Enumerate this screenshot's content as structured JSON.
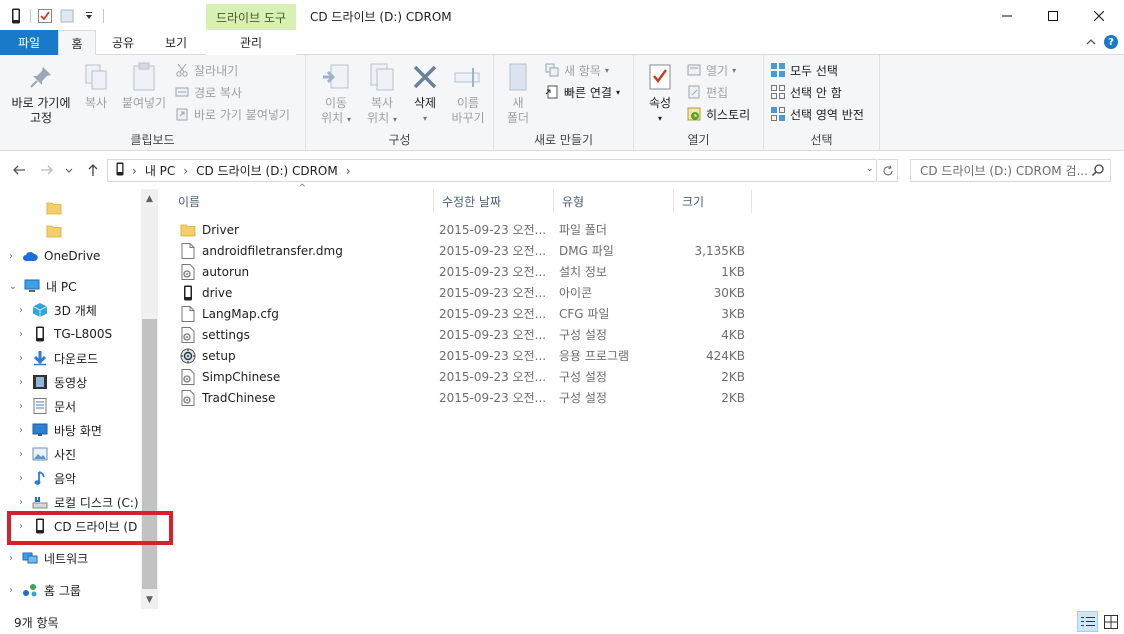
{
  "window": {
    "title": "CD 드라이브 (D:) CDROM",
    "context_tab_header": "드라이브 도구"
  },
  "ribbon_tabs": {
    "file": "파일",
    "home": "홈",
    "share": "공유",
    "view": "보기",
    "manage": "관리"
  },
  "ribbon": {
    "clipboard": {
      "label": "클립보드",
      "pin_line1": "바로 가기에",
      "pin_line2": "고정",
      "copy": "복사",
      "paste": "붙여넣기",
      "cut": "잘라내기",
      "copy_path": "경로 복사",
      "paste_shortcut": "바로 가기 붙여넣기"
    },
    "organize": {
      "label": "구성",
      "move_line1": "이동",
      "move_line2": "위치",
      "copy_line1": "복사",
      "copy_line2": "위치",
      "delete": "삭제",
      "rename_line1": "이름",
      "rename_line2": "바꾸기"
    },
    "new": {
      "label": "새로 만들기",
      "folder_line1": "새",
      "folder_line2": "폴더",
      "new_item": "새 항목",
      "easy_access": "빠른 연결"
    },
    "open": {
      "label": "열기",
      "properties": "속성",
      "open": "열기",
      "edit": "편집",
      "history": "히스토리"
    },
    "select": {
      "label": "선택",
      "select_all": "모두 선택",
      "select_none": "선택 안 함",
      "invert": "선택 영역 반전"
    }
  },
  "address": {
    "crumbs": [
      "내 PC",
      "CD 드라이브 (D:) CDROM"
    ],
    "search_placeholder": "CD 드라이브 (D:) CDROM 검..."
  },
  "nav_pane": {
    "items": [
      {
        "label": "",
        "icon": "folder-icon",
        "expand": ""
      },
      {
        "label": "",
        "icon": "folder-icon",
        "expand": ""
      },
      {
        "label": "OneDrive",
        "icon": "cloud-icon",
        "expand": "›"
      },
      {
        "label": "내 PC",
        "icon": "computer-icon",
        "expand": "⌄"
      },
      {
        "label": "3D 개체",
        "icon": "cube-icon",
        "expand": "›"
      },
      {
        "label": "TG-L800S",
        "icon": "phone-icon",
        "expand": "›"
      },
      {
        "label": "다운로드",
        "icon": "download-icon",
        "expand": "›"
      },
      {
        "label": "동영상",
        "icon": "video-icon",
        "expand": "›"
      },
      {
        "label": "문서",
        "icon": "document-icon",
        "expand": "›"
      },
      {
        "label": "바탕 화면",
        "icon": "desktop-icon",
        "expand": "›"
      },
      {
        "label": "사진",
        "icon": "picture-icon",
        "expand": "›"
      },
      {
        "label": "음악",
        "icon": "music-icon",
        "expand": "›"
      },
      {
        "label": "로컬 디스크 (C:)",
        "icon": "disk-icon",
        "expand": "›"
      },
      {
        "label": "CD 드라이브 (D",
        "icon": "cd-drive-icon",
        "expand": "›"
      },
      {
        "label": "네트워크",
        "icon": "network-icon",
        "expand": "›"
      },
      {
        "label": "홈 그룹",
        "icon": "homegroup-icon",
        "expand": "›"
      }
    ]
  },
  "file_list": {
    "columns": {
      "name": "이름",
      "date": "수정한 날짜",
      "type": "유형",
      "size": "크기"
    },
    "rows": [
      {
        "name": "Driver",
        "date": "2015-09-23 오전...",
        "type": "파일 폴더",
        "size": "",
        "icon": "folder-icon"
      },
      {
        "name": "androidfiletransfer.dmg",
        "date": "2015-09-23 오전...",
        "type": "DMG 파일",
        "size": "3,135KB",
        "icon": "file-icon"
      },
      {
        "name": "autorun",
        "date": "2015-09-23 오전...",
        "type": "설치 정보",
        "size": "1KB",
        "icon": "settings-file-icon"
      },
      {
        "name": "drive",
        "date": "2015-09-23 오전...",
        "type": "아이콘",
        "size": "30KB",
        "icon": "phone-icon"
      },
      {
        "name": "LangMap.cfg",
        "date": "2015-09-23 오전...",
        "type": "CFG 파일",
        "size": "3KB",
        "icon": "file-icon"
      },
      {
        "name": "settings",
        "date": "2015-09-23 오전...",
        "type": "구성 설정",
        "size": "4KB",
        "icon": "settings-file-icon"
      },
      {
        "name": "setup",
        "date": "2015-09-23 오전...",
        "type": "응용 프로그램",
        "size": "424KB",
        "icon": "setup-icon"
      },
      {
        "name": "SimpChinese",
        "date": "2015-09-23 오전...",
        "type": "구성 설정",
        "size": "2KB",
        "icon": "settings-file-icon"
      },
      {
        "name": "TradChinese",
        "date": "2015-09-23 오전...",
        "type": "구성 설정",
        "size": "2KB",
        "icon": "settings-file-icon"
      }
    ]
  },
  "status": {
    "count": "9개 항목"
  },
  "colors": {
    "accent": "#1979ca",
    "context_tab": "#d8f0b4",
    "highlight_box": "#d8202a",
    "folder": "#e8c25a"
  }
}
